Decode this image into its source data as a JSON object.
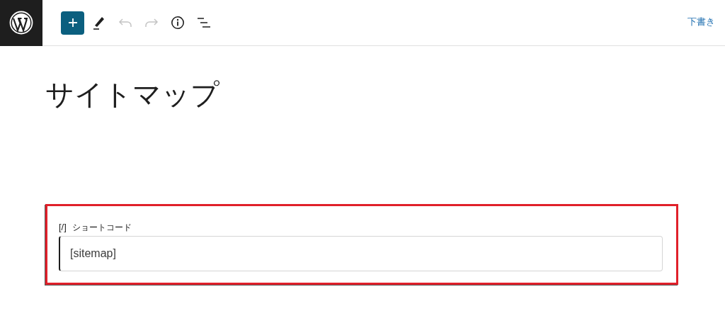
{
  "toolbar": {
    "items": [
      {
        "kind": "inserter",
        "disabled": false
      },
      {
        "kind": "tools",
        "disabled": false
      },
      {
        "kind": "undo",
        "disabled": true
      },
      {
        "kind": "redo",
        "disabled": true
      },
      {
        "kind": "details",
        "disabled": false
      },
      {
        "kind": "outline",
        "disabled": false
      }
    ],
    "save_draft": "下書き"
  },
  "post": {
    "title": "サイトマップ"
  },
  "block": {
    "selected": true,
    "icon_text": "[/]",
    "label": "ショートコード",
    "value": "[sitemap]"
  }
}
